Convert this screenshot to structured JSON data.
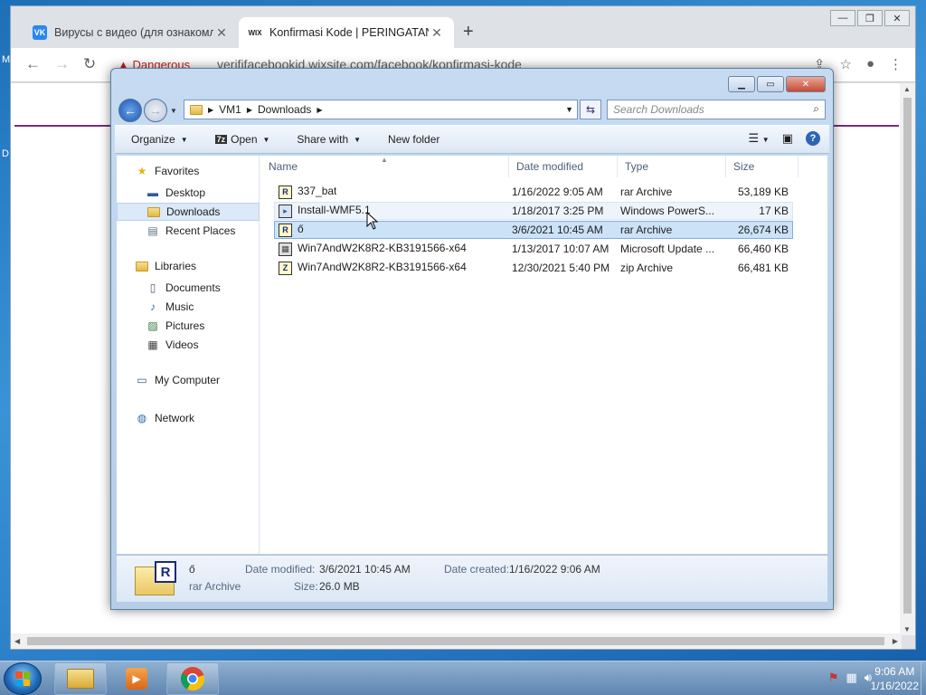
{
  "browser": {
    "tabs": [
      {
        "favicon": "VK",
        "title": "Вирусы с видео (для ознакомле",
        "close": "✕"
      },
      {
        "favicon": "WIX",
        "title": "Konfirmasi Kode | PERINGATAN",
        "close": "✕"
      }
    ],
    "new_tab": "+",
    "security_label": "Dangerous",
    "url": "verififacebookid.wixsite.com/facebook/konfirmasi-kode",
    "window_buttons": [
      "—",
      "❐",
      "✕"
    ]
  },
  "explorer": {
    "breadcrumb": [
      "VM1",
      "Downloads"
    ],
    "search_placeholder": "Search Downloads",
    "commands": {
      "organize": "Organize",
      "open": "Open",
      "share_with": "Share with",
      "new_folder": "New folder"
    },
    "nav": {
      "favorites": "Favorites",
      "desktop": "Desktop",
      "downloads": "Downloads",
      "recent_places": "Recent Places",
      "libraries": "Libraries",
      "documents": "Documents",
      "music": "Music",
      "pictures": "Pictures",
      "videos": "Videos",
      "my_computer": "My Computer",
      "network": "Network"
    },
    "columns": {
      "name": "Name",
      "date": "Date modified",
      "type": "Type",
      "size": "Size"
    },
    "files": [
      {
        "name": "337_bat",
        "date": "1/16/2022 9:05 AM",
        "type": "rar Archive",
        "size": "53,189 KB",
        "icon": "rar-icon"
      },
      {
        "name": "Install-WMF5.1",
        "date": "1/18/2017 3:25 PM",
        "type": "Windows PowerS...",
        "size": "17 KB",
        "icon": "powershell-icon"
      },
      {
        "name": "ő",
        "date": "3/6/2021 10:45 AM",
        "type": "rar Archive",
        "size": "26,674 KB",
        "icon": "rar-icon"
      },
      {
        "name": "Win7AndW2K8R2-KB3191566-x64",
        "date": "1/13/2017 10:07 AM",
        "type": "Microsoft Update ...",
        "size": "66,460 KB",
        "icon": "update-icon"
      },
      {
        "name": "Win7AndW2K8R2-KB3191566-x64",
        "date": "12/30/2021 5:40 PM",
        "type": "zip Archive",
        "size": "66,481 KB",
        "icon": "zip-icon"
      }
    ],
    "details": {
      "name": "ő",
      "type": "rar Archive",
      "date_modified_label": "Date modified:",
      "date_modified": "3/6/2021 10:45 AM",
      "date_created_label": "Date created:",
      "date_created": "1/16/2022 9:06 AM",
      "size_label": "Size:",
      "size": "26.0 MB"
    }
  },
  "taskbar": {
    "time": "9:06 AM",
    "date": "1/16/2022"
  }
}
